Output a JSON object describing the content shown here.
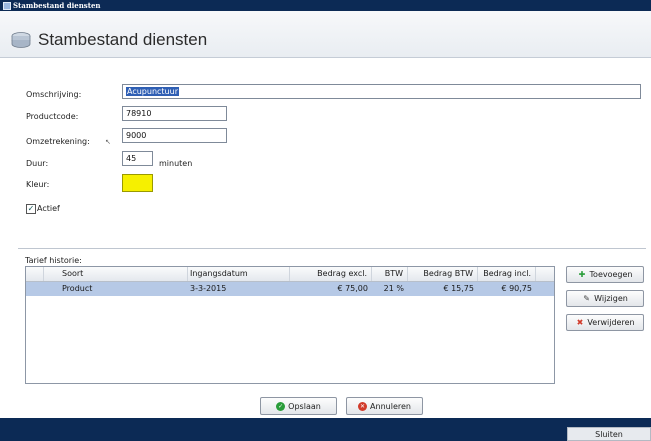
{
  "window": {
    "title": "Stambestand diensten"
  },
  "header": {
    "title": "Stambestand diensten",
    "icon": "stack-icon"
  },
  "form": {
    "omschrijving_label": "Omschrijving:",
    "omschrijving_value": "Acupunctuur",
    "productcode_label": "Productcode:",
    "productcode_value": "78910",
    "omzetrekening_label": "Omzetrekening:",
    "omzetrekening_value": "9000",
    "duur_label": "Duur:",
    "duur_value": "45",
    "duur_unit": "minuten",
    "kleur_label": "Kleur:",
    "kleur_value": "#f6f000",
    "actief_label": "Actief",
    "actief_checked": true
  },
  "tarief": {
    "label": "Tarief historie:",
    "columns": [
      "Soort",
      "Ingangsdatum",
      "Bedrag excl.",
      "BTW",
      "Bedrag BTW",
      "Bedrag incl."
    ],
    "rows": [
      [
        "Product",
        "3-3-2015",
        "€ 75,00",
        "21 %",
        "€ 15,75",
        "€ 90,75"
      ]
    ]
  },
  "side_buttons": {
    "toevoegen": "Toevoegen",
    "wijzigen": "Wijzigen",
    "verwijderen": "Verwijderen"
  },
  "bottom_buttons": {
    "opslaan": "Opslaan",
    "annuleren": "Annuleren"
  },
  "footer": {
    "sluiten": "Sluiten"
  },
  "colors": {
    "accent": "#0c2a55",
    "selection": "#b6c9e6",
    "ok_icon": "#2a9d3a",
    "cancel_icon": "#d13a2a"
  }
}
